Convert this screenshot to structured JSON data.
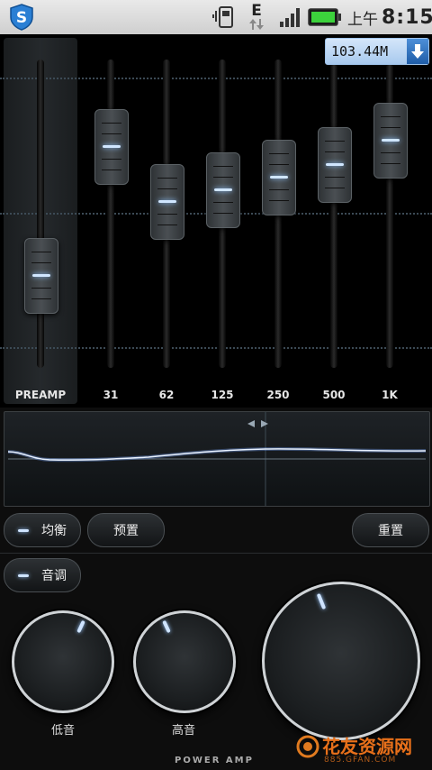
{
  "status_bar": {
    "network_type": "E",
    "ampm": "上午",
    "time": "8:15"
  },
  "eq": {
    "download_speed": "103.44M",
    "preamp": {
      "label": "PREAMP",
      "level": 0.3
    },
    "bands": [
      {
        "label": "31",
        "level": 0.72
      },
      {
        "label": "62",
        "level": 0.54
      },
      {
        "label": "125",
        "level": 0.58
      },
      {
        "label": "250",
        "level": 0.62
      },
      {
        "label": "500",
        "level": 0.66
      },
      {
        "label": "1K",
        "level": 0.74
      }
    ]
  },
  "controls": {
    "equalizer_label": "均衡",
    "presets_label": "预置",
    "reset_label": "重置",
    "tone_label": "音调"
  },
  "knobs": {
    "bass_label": "低音",
    "treble_label": "高音"
  },
  "brand": "POWER AMP",
  "watermark": {
    "text": "花友资源网",
    "url_text": "885.GFAN.COM"
  },
  "colors": {
    "accent_glow": "#cfe4ff",
    "speed_box": "#a8c9ee"
  }
}
